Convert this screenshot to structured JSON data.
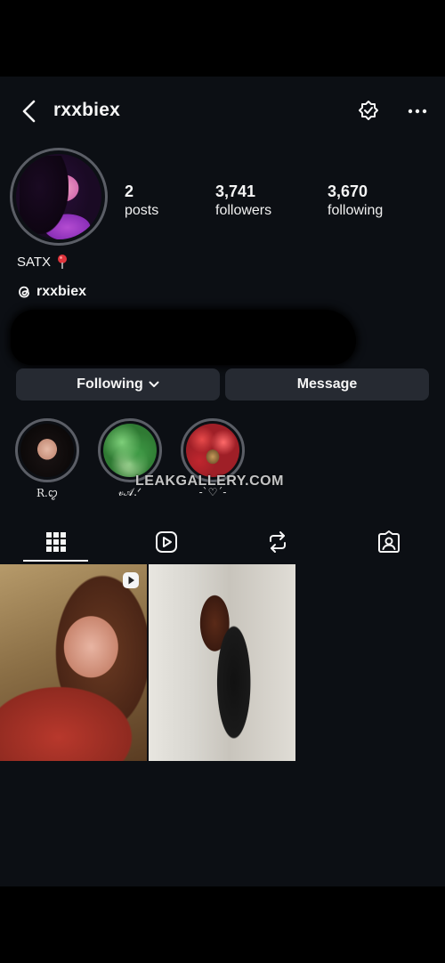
{
  "header": {
    "username": "rxxbiex"
  },
  "profile": {
    "stats": [
      {
        "value": "2",
        "label": "posts"
      },
      {
        "value": "3,741",
        "label": "followers"
      },
      {
        "value": "3,670",
        "label": "following"
      }
    ],
    "bio": "SATX",
    "threads_handle": "rxxbiex"
  },
  "actions": {
    "following_label": "Following",
    "message_label": "Message"
  },
  "highlights": [
    {
      "label": "R.ꨄ"
    },
    {
      "label": "𝓋𝒜.ᐟ"
    },
    {
      "label": "-ˋ♡ˊ-"
    }
  ],
  "watermark": "LEAKGALLERY.COM",
  "tabs": [
    {
      "icon": "grid-icon",
      "active": true
    },
    {
      "icon": "reels-icon",
      "active": false
    },
    {
      "icon": "reposts-icon",
      "active": false
    },
    {
      "icon": "tagged-icon",
      "active": false
    }
  ],
  "posts": [
    {
      "type": "reel"
    },
    {
      "type": "photo"
    }
  ],
  "colors": {
    "background": "#0c0f14",
    "button": "#262a32",
    "text": "#f5f5f5",
    "ring": "#5b5e66"
  }
}
